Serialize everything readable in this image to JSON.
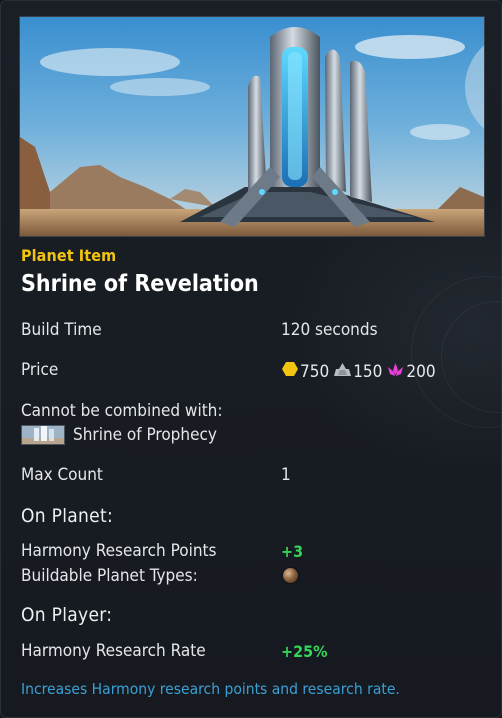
{
  "item": {
    "category": "Planet Item",
    "name": "Shrine of Revelation"
  },
  "build_time": {
    "label": "Build Time",
    "value": "120 seconds"
  },
  "price": {
    "label": "Price",
    "costs": [
      {
        "icon": "hexagon-credits-icon",
        "color": "#f0c40f",
        "amount": "750"
      },
      {
        "icon": "metal-ore-icon",
        "color": "#b8bcc2",
        "amount": "150"
      },
      {
        "icon": "crystal-lotus-icon",
        "color": "#e83fd8",
        "amount": "200"
      }
    ]
  },
  "combination": {
    "label": "Cannot be combined with:",
    "items": [
      {
        "name": "Shrine of Prophecy"
      }
    ]
  },
  "max_count": {
    "label": "Max Count",
    "value": "1"
  },
  "on_planet": {
    "heading": "On Planet:",
    "rows": [
      {
        "label": "Harmony Research Points",
        "value": "+3"
      },
      {
        "label": "Buildable Planet Types:",
        "icon": "desert-planet-icon"
      }
    ]
  },
  "on_player": {
    "heading": "On Player:",
    "rows": [
      {
        "label": "Harmony Research Rate",
        "value": "+25%"
      }
    ]
  },
  "description": "Increases Harmony research points and research rate.",
  "colors": {
    "accent_category": "#f0c40f",
    "positive_value": "#34d35a",
    "description": "#3aa0d4",
    "background": "#161a20"
  }
}
